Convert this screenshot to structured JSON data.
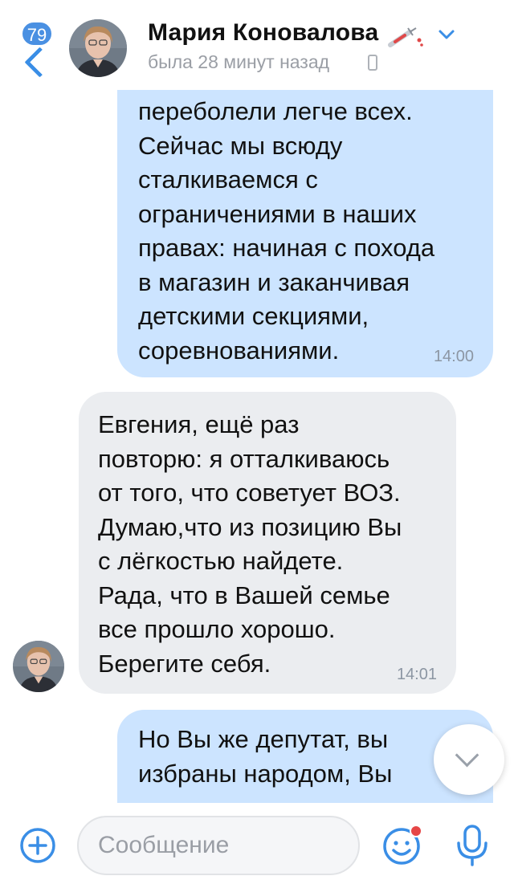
{
  "header": {
    "unread_count": "79",
    "contact_name": "Мария Коновалова",
    "status": "была 28 минут назад"
  },
  "messages": [
    {
      "direction": "outgoing",
      "lines": [
        "переболели легче всех.",
        "Сейчас мы всюду",
        "сталкиваемся с",
        "ограничениями в наших",
        "правах: начиная с похода",
        "в магазин и заканчивая",
        "детскими секциями,",
        "соревнованиями."
      ],
      "time": "14:00"
    },
    {
      "direction": "incoming",
      "lines": [
        "Евгения, ещё раз",
        "повторю: я отталкиваюсь",
        "от того, что советует ВОЗ.",
        "Думаю,что из позицию Вы",
        "с лёгкостью найдете.",
        "Рада, что в Вашей семье",
        "все прошло хорошо.",
        "Берегите себя."
      ],
      "time": "14:01"
    },
    {
      "direction": "outgoing",
      "lines": [
        "Но Вы же депутат, вы",
        "избраны народом, Вы"
      ]
    }
  ],
  "composer": {
    "placeholder": "Сообщение"
  },
  "icons": {
    "back": "chevron-left-icon",
    "emoji": "smile-icon",
    "mic": "microphone-icon",
    "add": "plus-circle-icon",
    "scroll": "chevron-down-icon"
  },
  "colors": {
    "accent": "#3a8ee6",
    "outgoing_bubble": "#cce4ff",
    "incoming_bubble": "#ebedf0",
    "notification_dot": "#e64646"
  }
}
